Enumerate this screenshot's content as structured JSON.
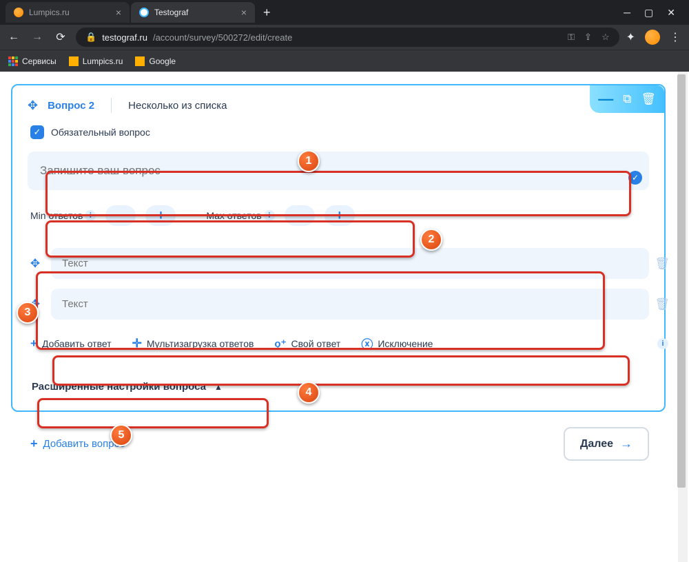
{
  "browser": {
    "tabs": [
      {
        "title": "Lumpics.ru",
        "active": false
      },
      {
        "title": "Testograf",
        "active": true
      }
    ],
    "url_prefix": "testograf.ru",
    "url_path": "/account/survey/500272/edit/create",
    "bookmarks": [
      "Сервисы",
      "Lumpics.ru",
      "Google"
    ]
  },
  "question": {
    "drag_label": "Вопрос 2",
    "type_label": "Несколько из списка",
    "required_label": "Обязательный вопрос",
    "input_placeholder": "Запишите ваш вопрос",
    "min_label": "Min ответов",
    "max_label": "Max ответов",
    "answers": [
      "Текст",
      "Текст"
    ],
    "actions": {
      "add_answer": "Добавить ответ",
      "bulk_upload": "Мультизагрузка ответов",
      "own_answer": "Свой ответ",
      "exclusion": "Исключение"
    },
    "advanced_label": "Расширенные настройки вопроса"
  },
  "footer": {
    "add_question": "Добавить вопрос",
    "next": "Далее"
  },
  "annotations": [
    "1",
    "2",
    "3",
    "4",
    "5"
  ]
}
